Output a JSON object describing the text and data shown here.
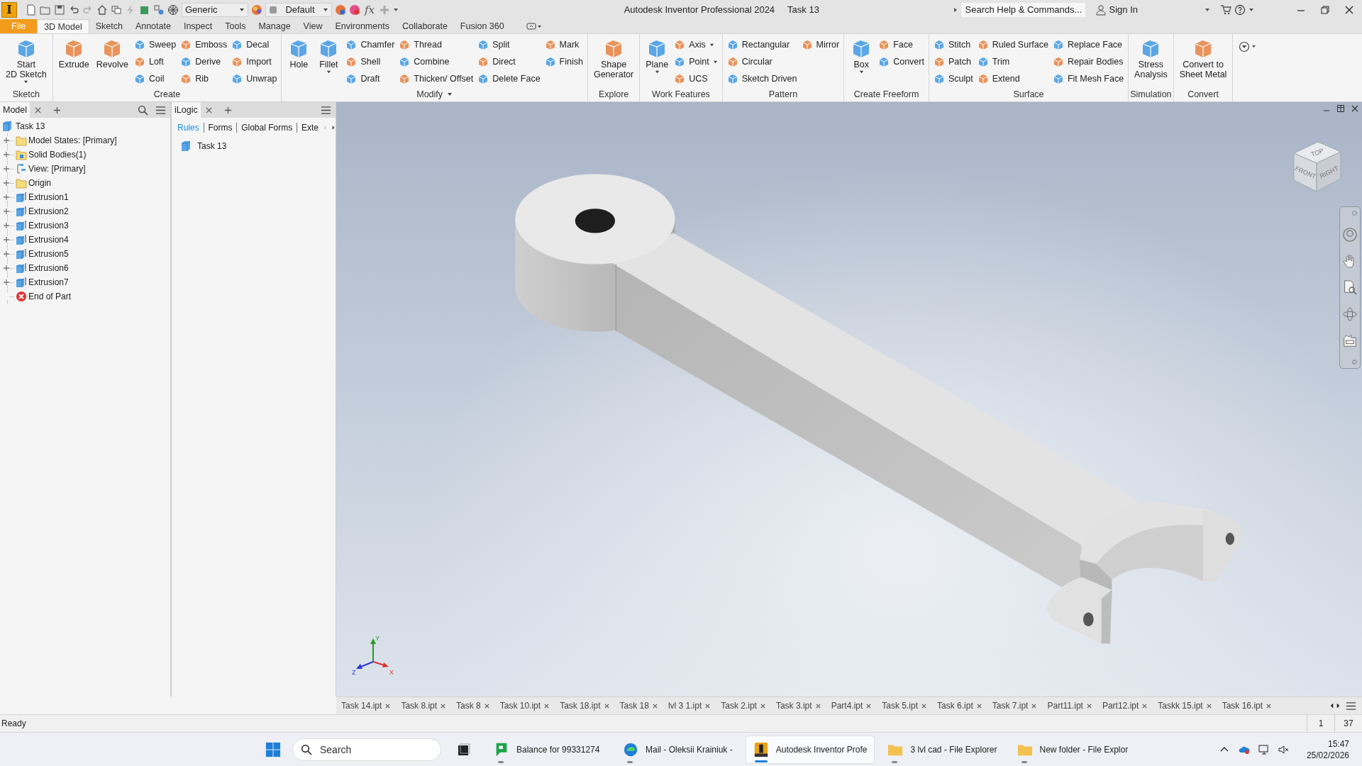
{
  "title_bar": {
    "logo": "I",
    "material_dropdown": "Generic",
    "appearance_dropdown": "Default",
    "formula_symbol": "fx",
    "title": "Autodesk Inventor Professional 2024",
    "document": "Task 13",
    "search": {
      "placeholder": "Search Help & Commands..."
    },
    "sign_in": "Sign In"
  },
  "ribbon_tabs": [
    {
      "label": "File",
      "kind": "file",
      "selected": false
    },
    {
      "label": "3D Model",
      "kind": "tab",
      "selected": true
    },
    {
      "label": "Sketch",
      "kind": "tab",
      "selected": false
    },
    {
      "label": "Annotate",
      "kind": "tab",
      "selected": false
    },
    {
      "label": "Inspect",
      "kind": "tab",
      "selected": false
    },
    {
      "label": "Tools",
      "kind": "tab",
      "selected": false
    },
    {
      "label": "Manage",
      "kind": "tab",
      "selected": false
    },
    {
      "label": "View",
      "kind": "tab",
      "selected": false
    },
    {
      "label": "Environments",
      "kind": "tab",
      "selected": false
    },
    {
      "label": "Collaborate",
      "kind": "tab",
      "selected": false
    },
    {
      "label": "Fusion 360",
      "kind": "tab",
      "selected": false
    }
  ],
  "ribbon_panels": [
    {
      "title": "Sketch",
      "items": [
        {
          "kind": "large",
          "label": "Start\n2D Sketch",
          "dropdown": true
        }
      ]
    },
    {
      "title": "Create",
      "items": [
        {
          "kind": "large",
          "label": "Extrude",
          "dropdown": false
        },
        {
          "kind": "large",
          "label": "Revolve",
          "dropdown": false
        },
        {
          "kind": "column",
          "tools": [
            {
              "label": "Sweep",
              "dropdown": false
            },
            {
              "label": "Loft",
              "dropdown": false
            },
            {
              "label": "Coil",
              "dropdown": false
            }
          ]
        },
        {
          "kind": "column",
          "tools": [
            {
              "label": "Emboss",
              "dropdown": false
            },
            {
              "label": "Derive",
              "dropdown": false
            },
            {
              "label": "Rib",
              "dropdown": false
            }
          ]
        },
        {
          "kind": "column",
          "tools": [
            {
              "label": "Decal",
              "dropdown": false
            },
            {
              "label": "Import",
              "dropdown": false
            },
            {
              "label": "Unwrap",
              "dropdown": false
            }
          ]
        }
      ]
    },
    {
      "title": "Modify",
      "menu": true,
      "items": [
        {
          "kind": "large",
          "label": "Hole",
          "dropdown": false
        },
        {
          "kind": "large",
          "label": "Fillet",
          "dropdown": true
        },
        {
          "kind": "column",
          "tools": [
            {
              "label": "Chamfer",
              "dropdown": false
            },
            {
              "label": "Shell",
              "dropdown": false
            },
            {
              "label": "Draft",
              "dropdown": false
            }
          ]
        },
        {
          "kind": "column",
          "tools": [
            {
              "label": "Thread",
              "dropdown": false
            },
            {
              "label": "Combine",
              "dropdown": false
            },
            {
              "label": "Thicken/ Offset",
              "dropdown": false
            }
          ]
        },
        {
          "kind": "column",
          "tools": [
            {
              "label": "Split",
              "dropdown": false
            },
            {
              "label": "Direct",
              "dropdown": false
            },
            {
              "label": "Delete Face",
              "dropdown": false
            }
          ]
        },
        {
          "kind": "column",
          "tools": [
            {
              "label": "Mark",
              "dropdown": false
            },
            {
              "label": "Finish",
              "dropdown": false
            }
          ]
        }
      ]
    },
    {
      "title": "Explore",
      "items": [
        {
          "kind": "large",
          "label": "Shape\nGenerator",
          "dropdown": false
        }
      ]
    },
    {
      "title": "Work Features",
      "items": [
        {
          "kind": "large",
          "label": "Plane",
          "dropdown": true
        },
        {
          "kind": "column",
          "tools": [
            {
              "label": "Axis",
              "dropdown": true
            },
            {
              "label": "Point",
              "dropdown": true
            },
            {
              "label": "UCS",
              "dropdown": false
            }
          ]
        }
      ]
    },
    {
      "title": "Pattern",
      "items": [
        {
          "kind": "column",
          "tools": [
            {
              "label": "Rectangular",
              "dropdown": false
            },
            {
              "label": "Circular",
              "dropdown": false
            },
            {
              "label": "Sketch Driven",
              "dropdown": false
            }
          ]
        },
        {
          "kind": "column",
          "tools": [
            {
              "label": "Mirror",
              "dropdown": false
            }
          ]
        }
      ]
    },
    {
      "title": "Create Freeform",
      "items": [
        {
          "kind": "large",
          "label": "Box",
          "dropdown": true
        },
        {
          "kind": "column",
          "tools": [
            {
              "label": "Face",
              "dropdown": false
            },
            {
              "label": "Convert",
              "dropdown": false
            }
          ]
        }
      ]
    },
    {
      "title": "Surface",
      "items": [
        {
          "kind": "column",
          "tools": [
            {
              "label": "Stitch",
              "dropdown": false
            },
            {
              "label": "Patch",
              "dropdown": false
            },
            {
              "label": "Sculpt",
              "dropdown": false
            }
          ]
        },
        {
          "kind": "column",
          "tools": [
            {
              "label": "Ruled Surface",
              "dropdown": false
            },
            {
              "label": "Trim",
              "dropdown": false
            },
            {
              "label": "Extend",
              "dropdown": false
            }
          ]
        },
        {
          "kind": "column",
          "tools": [
            {
              "label": "Replace Face",
              "dropdown": false
            },
            {
              "label": "Repair Bodies",
              "dropdown": false
            },
            {
              "label": "Fit Mesh Face",
              "dropdown": false
            }
          ]
        }
      ]
    },
    {
      "title": "Simulation",
      "items": [
        {
          "kind": "large",
          "label": "Stress\nAnalysis",
          "dropdown": false
        }
      ]
    },
    {
      "title": "Convert",
      "items": [
        {
          "kind": "large",
          "label": "Convert to\nSheet Metal",
          "dropdown": false
        }
      ]
    }
  ],
  "model_browser": {
    "tab": "Model",
    "tree": [
      {
        "label": "Task 13",
        "kind": "part",
        "children": [
          {
            "label": "Model States: [Primary]",
            "kind": "folder",
            "expanded": false
          },
          {
            "label": "Solid Bodies(1)",
            "kind": "bodies",
            "expanded": false
          },
          {
            "label": "View: [Primary]",
            "kind": "view",
            "expanded": false
          },
          {
            "label": "Origin",
            "kind": "folder",
            "expanded": false
          },
          {
            "label": "Extrusion1",
            "kind": "extrusion",
            "expanded": false
          },
          {
            "label": "Extrusion2",
            "kind": "extrusion",
            "expanded": false
          },
          {
            "label": "Extrusion3",
            "kind": "extrusion",
            "expanded": false
          },
          {
            "label": "Extrusion4",
            "kind": "extrusion",
            "expanded": false
          },
          {
            "label": "Extrusion5",
            "kind": "extrusion",
            "expanded": false
          },
          {
            "label": "Extrusion6",
            "kind": "extrusion",
            "expanded": false
          },
          {
            "label": "Extrusion7",
            "kind": "extrusion",
            "expanded": false
          },
          {
            "label": "End of Part",
            "kind": "end"
          }
        ]
      }
    ]
  },
  "ilogic": {
    "tab": "iLogic",
    "subtabs": [
      {
        "label": "Rules",
        "selected": true
      },
      {
        "label": "Forms",
        "selected": false
      },
      {
        "label": "Global Forms",
        "selected": false
      },
      {
        "label": "Exte",
        "selected": false
      }
    ],
    "items": [
      "Task 13"
    ]
  },
  "viewport": {
    "viewcube": {
      "top": "TOP",
      "front": "FRONT",
      "right": "RIGHT"
    },
    "triad": {
      "x": "X",
      "y": "Y",
      "z": "Z"
    }
  },
  "document_tabs": [
    "Task 14.ipt",
    "Task 8.ipt",
    "Task 8",
    "Task 10.ipt",
    "Task 18.ipt",
    "Task 18",
    "lvl 3 1.ipt",
    "Task 2.ipt",
    "Task 3.ipt",
    "Part4.ipt",
    "Task 5.ipt",
    "Task 6.ipt",
    "Task 7.ipt",
    "Part11.ipt",
    "Part12.ipt",
    "Taskk 15.ipt",
    "Task 16.ipt"
  ],
  "status_bar": {
    "message": "Ready",
    "field_1": "1",
    "field_2": "37"
  },
  "taskbar": {
    "search": {
      "placeholder": "Search"
    },
    "apps": [
      {
        "label": "Balance for 99331274",
        "kind": "chat",
        "selected": false
      },
      {
        "label": "Mail - Oleksii Krainiuk -",
        "kind": "browser",
        "selected": false
      },
      {
        "label": "Autodesk Inventor Profe",
        "kind": "inventor",
        "selected": true
      },
      {
        "label": "3 lvl cad - File Explorer",
        "kind": "explorer",
        "selected": false
      },
      {
        "label": "New folder - File Explor",
        "kind": "explorer",
        "selected": false
      }
    ],
    "time": "15:47",
    "date": "25/02/2026"
  }
}
